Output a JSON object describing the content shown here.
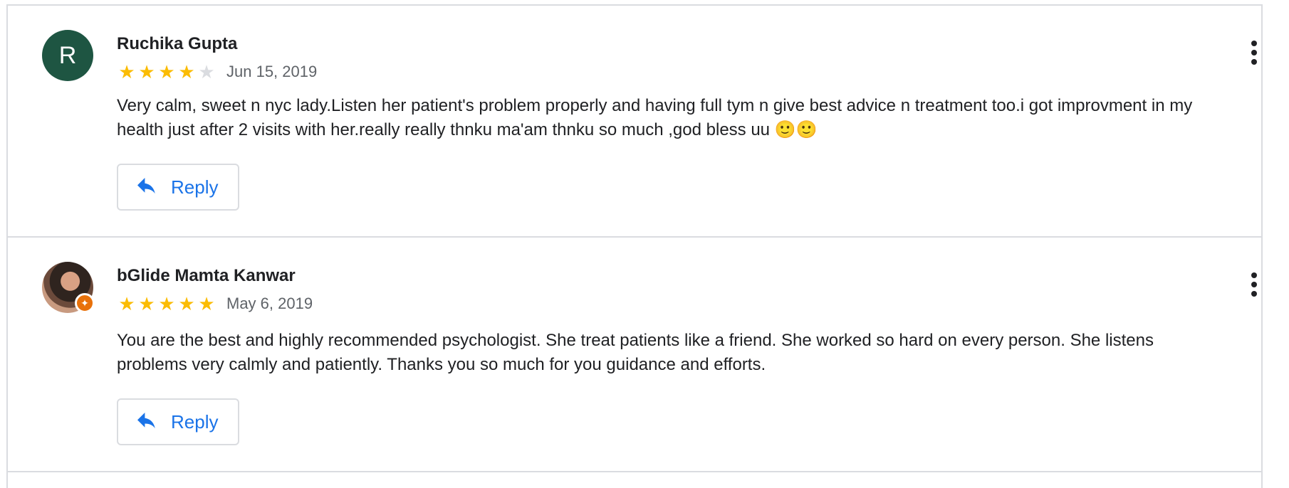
{
  "reviews": [
    {
      "author": "Ruchika Gupta",
      "avatar_letter": "R",
      "rating": 4,
      "max_rating": 5,
      "date": "Jun 15, 2019",
      "text": "Very calm, sweet n nyc lady.Listen her patient's problem properly and having full tym n give best advice n treatment too.i got improvment in my health just after 2 visits with her.really really thnku ma'am thnku so much ,god bless uu 🙂🙂",
      "reply_label": "Reply",
      "menu_icon": "more-vert-icon"
    },
    {
      "author": "bGlide Mamta Kanwar",
      "avatar_letter": "",
      "rating": 5,
      "max_rating": 5,
      "date": "May 6, 2019",
      "text": "You are the best and highly recommended psychologist. She treat patients like a friend. She worked so hard on every person. She listens problems very calmly and patiently. Thanks you so much for you guidance and efforts.",
      "reply_label": "Reply",
      "menu_icon": "more-vert-icon"
    }
  ],
  "colors": {
    "star_on": "#fbbc04",
    "star_off": "#dadce0",
    "reply_accent": "#1a73e8",
    "avatar_bg": "#1e5542",
    "local_guide_badge": "#e8710a"
  }
}
